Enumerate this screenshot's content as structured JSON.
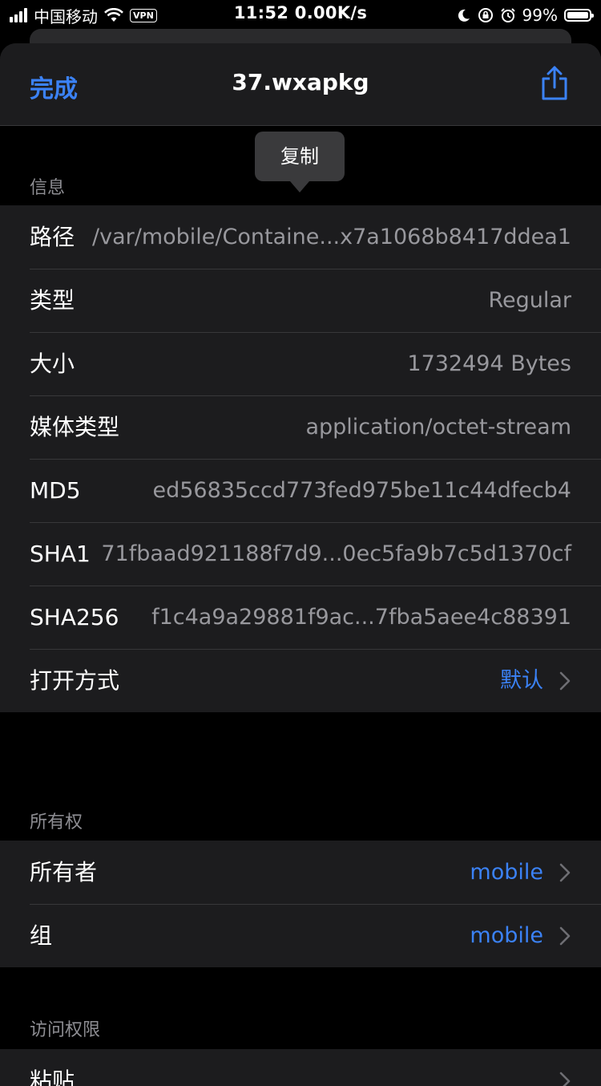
{
  "status_bar": {
    "carrier": "中国移动",
    "vpn": "VPN",
    "time_speed": "11:52 0.00K/s",
    "battery": "99%"
  },
  "nav": {
    "done": "完成",
    "title": "37.wxapkg",
    "share_icon": "share-icon"
  },
  "tooltip": {
    "label": "复制"
  },
  "info": {
    "header": "信息",
    "rows": [
      {
        "label": "路径",
        "value": "/var/mobile/Containe...x7a1068b8417ddea1"
      },
      {
        "label": "类型",
        "value": "Regular"
      },
      {
        "label": "大小",
        "value": "1732494 Bytes"
      },
      {
        "label": "媒体类型",
        "value": "application/octet-stream"
      },
      {
        "label": "MD5",
        "value": "ed56835ccd773fed975be11c44dfecb4"
      },
      {
        "label": "SHA1",
        "value": "71fbaad921188f7d9...0ec5fa9b7c5d1370cf"
      },
      {
        "label": "SHA256",
        "value": "f1c4a9a29881f9ac...7fba5aee4c88391"
      },
      {
        "label": "打开方式",
        "value": "默认"
      }
    ]
  },
  "ownership": {
    "header": "所有权",
    "rows": [
      {
        "label": "所有者",
        "value": "mobile"
      },
      {
        "label": "组",
        "value": "mobile"
      }
    ]
  },
  "access": {
    "header": "访问权限",
    "rows": [
      {
        "label": "粘贴"
      }
    ]
  },
  "colors": {
    "accent": "#3b82f6",
    "background": "#000000",
    "cell": "#1c1c1e",
    "secondary_text": "#98989d"
  }
}
